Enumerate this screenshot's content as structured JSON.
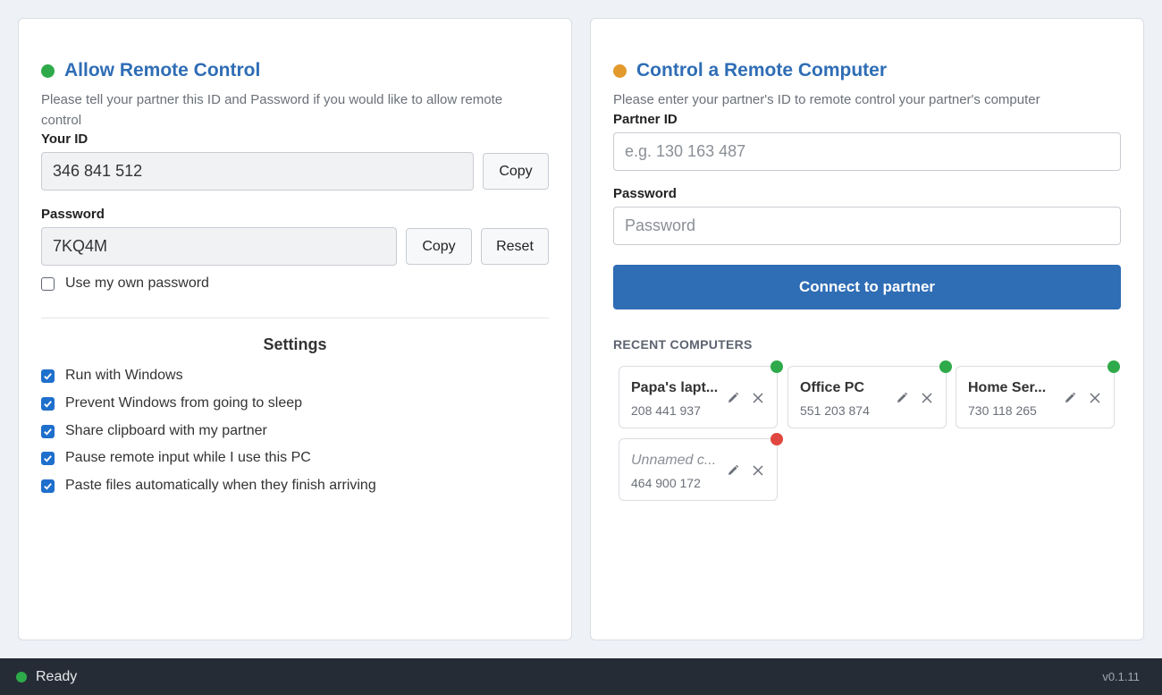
{
  "colors": {
    "accent": "#2f6db5",
    "online": "#2eaa4a",
    "offline": "#e0473e",
    "pending": "#e39a2d",
    "statusbar_bg": "#262c36"
  },
  "allow_panel": {
    "title": "Allow Remote Control",
    "status_color": "#2eaa4a",
    "description": "Please tell your partner this ID and Password if you would like to allow remote control",
    "your_id_label": "Your ID",
    "your_id_value": "346 841 512",
    "copy_id_label": "Copy",
    "password_label": "Password",
    "password_value": "7KQ4M",
    "copy_password_label": "Copy",
    "reset_label": "Reset",
    "own_password_label": "Use my own password",
    "own_password_checked": false,
    "settings_title": "Settings",
    "settings": [
      {
        "label": "Run with Windows",
        "checked": true
      },
      {
        "label": "Prevent Windows from going to sleep",
        "checked": true
      },
      {
        "label": "Share clipboard with my partner",
        "checked": true
      },
      {
        "label": "Pause remote input while I use this PC",
        "checked": true
      },
      {
        "label": "Paste files automatically when they finish arriving",
        "checked": true
      }
    ]
  },
  "control_panel": {
    "title": "Control a Remote Computer",
    "status_color": "#e39a2d",
    "description": "Please enter your partner's ID to remote control your partner's computer",
    "partner_id_label": "Partner ID",
    "partner_id_placeholder": "e.g. 130 163 487",
    "password_label": "Password",
    "password_placeholder": "Password",
    "connect_label": "Connect to partner",
    "recent_title": "RECENT COMPUTERS",
    "recent": [
      {
        "name": "Papa's lapt...",
        "id": "208 441 937",
        "status": "online",
        "unnamed": false
      },
      {
        "name": "Office PC",
        "id": "551 203 874",
        "status": "online",
        "unnamed": false
      },
      {
        "name": "Home Ser...",
        "id": "730 118 265",
        "status": "online",
        "unnamed": false
      },
      {
        "name": "Unnamed c...",
        "id": "464 900 172",
        "status": "offline",
        "unnamed": true
      }
    ]
  },
  "statusbar": {
    "status": "Ready",
    "status_color": "#2eaa4a",
    "version": "v0.1.11"
  }
}
